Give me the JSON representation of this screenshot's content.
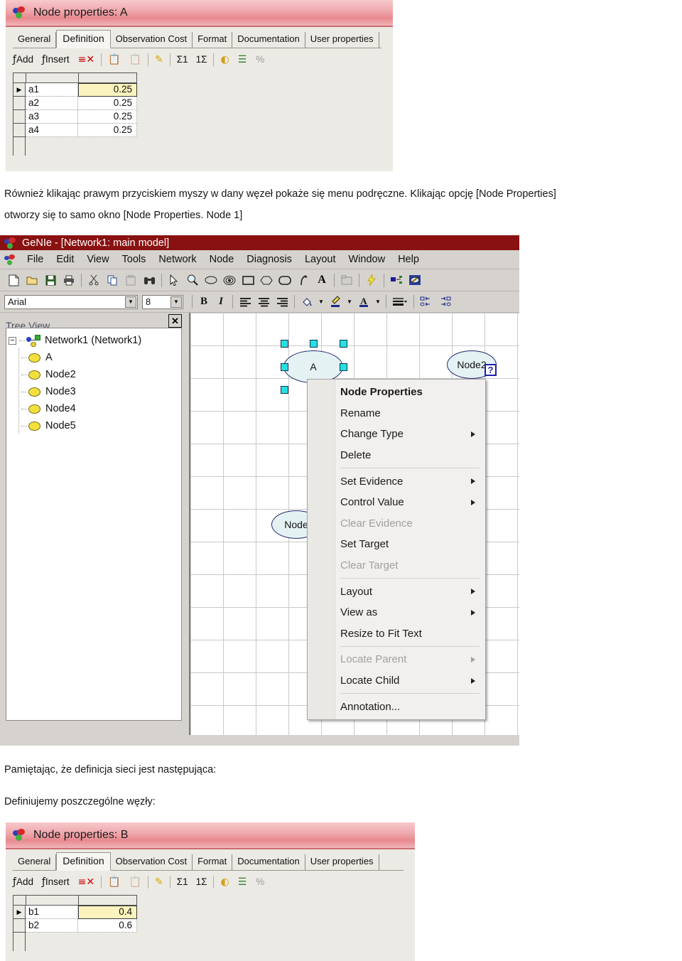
{
  "dialog_a": {
    "title": "Node properties: A",
    "logo_icon": "genie-logo-icon",
    "tabs": [
      "General",
      "Definition",
      "Observation Cost",
      "Format",
      "Documentation",
      "User properties"
    ],
    "active_tab": "Definition",
    "toolbar": {
      "add_label": "Add",
      "insert_label": "Insert",
      "delete_icon": "delete-row-icon",
      "copy_icon": "copy-icon",
      "paste_icon": "paste-icon",
      "note_icon": "note-icon",
      "sum_row_label": "Σ1",
      "sum_col_label": "1Σ",
      "pie_icon": "pie-chart-icon",
      "bar_icon": "bar-chart-icon",
      "percent_label": "%"
    },
    "rows": [
      {
        "marker": "▶",
        "state": "a1",
        "value": "0.25",
        "selected": true
      },
      {
        "marker": "",
        "state": "a2",
        "value": "0.25",
        "selected": false
      },
      {
        "marker": "",
        "state": "a3",
        "value": "0.25",
        "selected": false
      },
      {
        "marker": "",
        "state": "a4",
        "value": "0.25",
        "selected": false
      }
    ]
  },
  "paragraph_1": {
    "line1": "Również klikając prawym przyciskiem myszy w dany węzeł pokaże się menu podręczne. Klikając opcję [Node Properties]",
    "line2": "otworzy się to samo okno [Node Properties. Node 1]"
  },
  "genie_window": {
    "title": "GeNIe - [Network1: main model]",
    "menu": [
      "File",
      "Edit",
      "View",
      "Tools",
      "Network",
      "Node",
      "Diagnosis",
      "Layout",
      "Window",
      "Help"
    ],
    "toolbar_icons": [
      "new-file-icon",
      "open-folder-icon",
      "save-icon",
      "print-icon",
      "cut-scissors-icon",
      "copy-icon",
      "paste-icon",
      "find-binoculars-icon",
      "pointer-arrow-icon",
      "zoom-magnifier-icon",
      "chance-node-icon",
      "decision-target-icon",
      "rectangle-node-icon",
      "diamond-node-icon",
      "rounded-node-icon",
      "arc-arrow-icon",
      "text-label-icon",
      "submodel-icon",
      "lightning-update-icon",
      "network-icon",
      "diagnosis-icon"
    ],
    "format_toolbar": {
      "font_value": "Arial",
      "font_size_value": "8",
      "bold_label": "B",
      "italic_label": "I",
      "align_left_icon": "align-left-icon",
      "align_center_icon": "align-center-icon",
      "align_right_icon": "align-right-icon",
      "fill_color_icon": "fill-color-icon",
      "line_color_icon": "line-color-icon",
      "font_color_icon": "font-color-icon",
      "line_width_icon": "line-width-icon",
      "align_objects_left_icon": "align-objects-left-icon",
      "align_objects_right_icon": "align-objects-right-icon"
    },
    "tree_view": {
      "caption": "Tree View",
      "close_label": "✕",
      "root": {
        "label": "Network1 (Network1)",
        "expander": "−",
        "icon": "network-tree-icon"
      },
      "nodes": [
        {
          "label": "A",
          "icon": "chance-node-icon"
        },
        {
          "label": "Node2",
          "icon": "chance-node-icon"
        },
        {
          "label": "Node3",
          "icon": "chance-node-icon"
        },
        {
          "label": "Node4",
          "icon": "chance-node-icon"
        },
        {
          "label": "Node5",
          "icon": "chance-node-icon"
        }
      ]
    },
    "canvas": {
      "node_a": {
        "label": "A",
        "selected": true
      },
      "node_2": {
        "label": "Node2",
        "badge": "?"
      },
      "node_partial": {
        "label": "Node"
      }
    },
    "context_menu": {
      "items": [
        {
          "label": "Node Properties",
          "bold": true,
          "disabled": false,
          "submenu": false,
          "sep_after": false
        },
        {
          "label": "Rename",
          "bold": false,
          "disabled": false,
          "submenu": false,
          "sep_after": false
        },
        {
          "label": "Change Type",
          "bold": false,
          "disabled": false,
          "submenu": true,
          "sep_after": false
        },
        {
          "label": "Delete",
          "bold": false,
          "disabled": false,
          "submenu": false,
          "sep_after": true
        },
        {
          "label": "Set Evidence",
          "bold": false,
          "disabled": false,
          "submenu": true,
          "sep_after": false
        },
        {
          "label": "Control Value",
          "bold": false,
          "disabled": false,
          "submenu": true,
          "sep_after": false
        },
        {
          "label": "Clear Evidence",
          "bold": false,
          "disabled": true,
          "submenu": false,
          "sep_after": false
        },
        {
          "label": "Set Target",
          "bold": false,
          "disabled": false,
          "submenu": false,
          "sep_after": false
        },
        {
          "label": "Clear Target",
          "bold": false,
          "disabled": true,
          "submenu": false,
          "sep_after": true
        },
        {
          "label": "Layout",
          "bold": false,
          "disabled": false,
          "submenu": true,
          "sep_after": false
        },
        {
          "label": "View as",
          "bold": false,
          "disabled": false,
          "submenu": true,
          "sep_after": false
        },
        {
          "label": "Resize to Fit Text",
          "bold": false,
          "disabled": false,
          "submenu": false,
          "sep_after": true
        },
        {
          "label": "Locate Parent",
          "bold": false,
          "disabled": true,
          "submenu": true,
          "sep_after": false
        },
        {
          "label": "Locate Child",
          "bold": false,
          "disabled": false,
          "submenu": true,
          "sep_after": true
        },
        {
          "label": "Annotation...",
          "bold": false,
          "disabled": false,
          "submenu": false,
          "sep_after": false
        }
      ]
    }
  },
  "paragraph_2": {
    "line1": "Pamiętając, że definicja sieci jest następująca:",
    "line2": "Definiujemy poszczególne węzły:"
  },
  "dialog_b": {
    "title": "Node properties: B",
    "logo_icon": "genie-logo-icon",
    "tabs": [
      "General",
      "Definition",
      "Observation Cost",
      "Format",
      "Documentation",
      "User properties"
    ],
    "active_tab": "Definition",
    "toolbar": {
      "add_label": "Add",
      "insert_label": "Insert",
      "percent_label": "%",
      "sum_row_label": "Σ1",
      "sum_col_label": "1Σ"
    },
    "rows": [
      {
        "marker": "▶",
        "state": "b1",
        "value": "0.4",
        "selected": true
      },
      {
        "marker": "",
        "state": "b2",
        "value": "0.6",
        "selected": false
      }
    ]
  },
  "colors": {
    "dialog_title_pink": "#efa8ad",
    "genie_title_red": "#8a1111",
    "selected_cell_yellow": "#fbf3bd",
    "node_fill": "#e5f2f4",
    "node_border": "#242a6b",
    "handle_cyan": "#25e0e0",
    "tree_node_yellow": "#f2e13c",
    "window_gray": "#d6d3ce"
  }
}
